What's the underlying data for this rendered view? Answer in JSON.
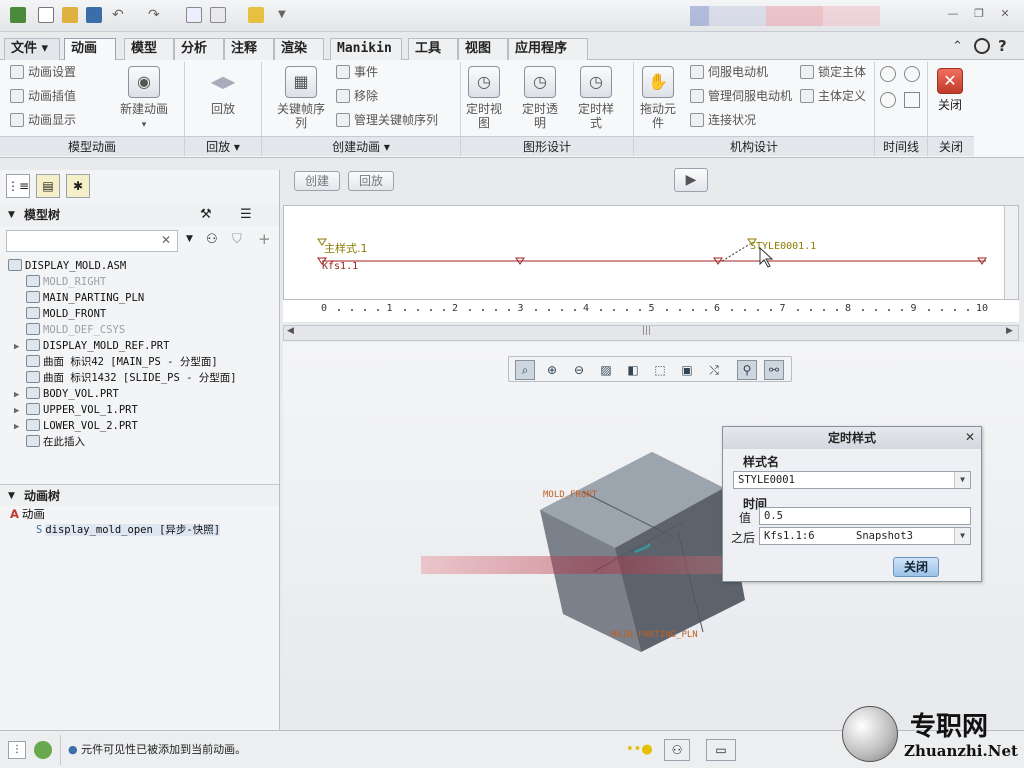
{
  "menu_tabs": [
    "文件",
    "动画",
    "模型",
    "分析",
    "注释",
    "渲染",
    "Manikin",
    "工具",
    "视图",
    "应用程序"
  ],
  "ribbon": {
    "model_animation": {
      "items": [
        "动画设置",
        "动画插值",
        "动画显示"
      ],
      "new_animation": "新建动画",
      "label": "模型动画"
    },
    "playback": {
      "play": "回放",
      "label": "回放"
    },
    "create_animation": {
      "keyframe_sequence": "关键帧序列",
      "event": "事件",
      "remove": "移除",
      "manage_keyframes": "管理关键帧序列",
      "label": "创建动画"
    },
    "graphics_design": {
      "timed_view": "定时视图",
      "timed_transparency": "定时透明",
      "timed_style": "定时样式",
      "label": "图形设计"
    },
    "mechanism_design": {
      "drag_components": "拖动元件",
      "servo_motor": "伺服电动机",
      "manage_servo": "管理伺服电动机",
      "connection_status": "连接状况",
      "lock_body": "锁定主体",
      "body_define": "主体定义",
      "label": "机构设计"
    },
    "timeline": {
      "label": "时间线"
    },
    "close": {
      "button": "关闭",
      "label": "关闭"
    }
  },
  "action_buttons": {
    "create": "创建",
    "playback": "回放"
  },
  "model_tree": {
    "title": "模型树",
    "items": [
      {
        "label": "DISPLAY_MOLD.ASM",
        "dim": false,
        "tri": ""
      },
      {
        "label": "MOLD_RIGHT",
        "dim": true,
        "tri": ""
      },
      {
        "label": "MAIN_PARTING_PLN",
        "dim": false,
        "tri": ""
      },
      {
        "label": "MOLD_FRONT",
        "dim": false,
        "tri": ""
      },
      {
        "label": "MOLD_DEF_CSYS",
        "dim": true,
        "tri": ""
      },
      {
        "label": "DISPLAY_MOLD_REF.PRT",
        "dim": false,
        "tri": "▶"
      },
      {
        "label": "曲面 标识42 [MAIN_PS - 分型面]",
        "dim": false,
        "tri": ""
      },
      {
        "label": "曲面 标识1432 [SLIDE_PS - 分型面]",
        "dim": false,
        "tri": ""
      },
      {
        "label": "BODY_VOL.PRT",
        "dim": false,
        "tri": "▶"
      },
      {
        "label": "UPPER_VOL_1.PRT",
        "dim": false,
        "tri": "▶"
      },
      {
        "label": "LOWER_VOL_2.PRT",
        "dim": false,
        "tri": "▶"
      },
      {
        "label": "在此插入",
        "dim": false,
        "tri": ""
      }
    ]
  },
  "animation_tree": {
    "title": "动画树",
    "root": "动画",
    "child": "display_mold_open [异步-快照]"
  },
  "timeline": {
    "style_label": "主样式.1",
    "keyframe_label": "Kfs1.1",
    "style2_label": "STYLE0001.1",
    "ruler": [
      "0",
      "1",
      "2",
      "3",
      "4",
      "5",
      "6",
      "7",
      "8",
      "9",
      "10"
    ]
  },
  "model_labels": {
    "front": "MOLD_FRONT",
    "parting": "MAIN_PARTING_PLN"
  },
  "dialog": {
    "title": "定时样式",
    "style_name_label": "样式名",
    "style_name": "STYLE0001",
    "time_label": "时间",
    "value_label": "值",
    "value": "0.5",
    "after_label": "之后",
    "after_value": "Kfs1.1:6",
    "snapshot": "Snapshot3",
    "close": "关闭"
  },
  "status": {
    "message": "元件可见性已被添加到当前动画。"
  },
  "watermark": {
    "cn": "专职网",
    "url": "Zhuanzhi.Net"
  },
  "colors": {
    "accent": "#c0392b",
    "timeline_line": "#a02020",
    "style_label": "#8a7a00"
  }
}
